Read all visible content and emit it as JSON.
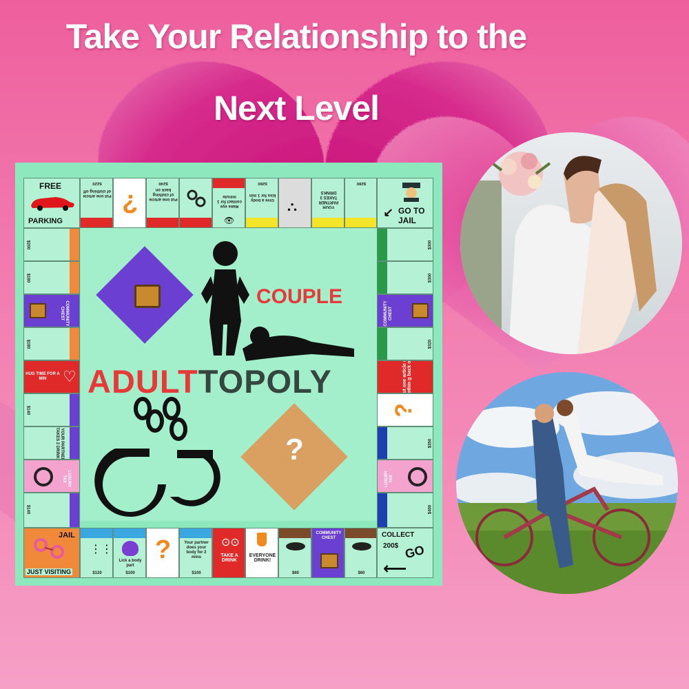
{
  "headline": {
    "line1": "Take Your Relationship to the",
    "line2": "Next Level"
  },
  "board": {
    "game_title_part1": "ADULT",
    "game_title_part2": "OPOLY",
    "game_title_letter_t": "T",
    "subtitle": "COUPLE",
    "corners": {
      "free_parking": [
        "FREE",
        "PARKING"
      ],
      "go_to_jail": [
        "GO TO",
        "JAIL"
      ],
      "jail": [
        "JAIL",
        "JUST VISITING"
      ],
      "go": [
        "COLLECT",
        "200$",
        "GO"
      ]
    },
    "top_row": [
      "Put one article of clothing off",
      "?",
      "Put one article of clothing back on",
      "",
      "Make eye contact for 1 minute",
      "Give a body kiss for 1 min",
      "Your partner takes 3 drinks",
      "YOUR PARTNER TAKES 3 DRINKS",
      ""
    ],
    "top_prices": [
      "$220",
      "",
      "$240",
      "",
      "$260",
      "",
      "",
      "",
      "$280"
    ],
    "bottom_row": [
      "",
      "Lick a body part",
      "",
      "?",
      "Your partner does your body for 2 mins",
      "TAKE A DRINK",
      "EVERYONE DRINK!",
      "",
      "COMMUNITY CHEST",
      ""
    ],
    "bottom_prices": [
      "$120",
      "$100",
      "",
      "$100",
      "",
      "",
      "$60",
      "",
      "$60"
    ],
    "left_col": [
      "",
      "",
      "COMMUNITY CHEST",
      "",
      "HUG TIME FOR A MIN",
      "",
      "YOUR PARTNER TAKES 2 DRINKS",
      "LUXURY TAX",
      ""
    ],
    "left_prices": [
      "$200",
      "$180",
      "",
      "$180",
      "",
      "$140",
      "",
      "",
      "$140"
    ],
    "right_col": [
      "",
      "",
      "COMMUNITY CHEST",
      "Your partner does your body for 2 mins",
      "Put one article of clothin g back on.",
      "?",
      "",
      "LUXURY TAX",
      ""
    ],
    "right_prices": [
      "$300",
      "$300",
      "",
      "$320",
      "",
      "",
      "$350",
      "",
      "$400"
    ],
    "question_mark": "?"
  },
  "colors": {
    "board_bg": "#8ee8bd",
    "cell_bg": "#b5f1d5",
    "title_red": "#e7393a",
    "title_dark": "#35463f",
    "purple": "#6a3fd1",
    "orange_card": "#d9a062",
    "pink_heart": "#e0287f"
  }
}
